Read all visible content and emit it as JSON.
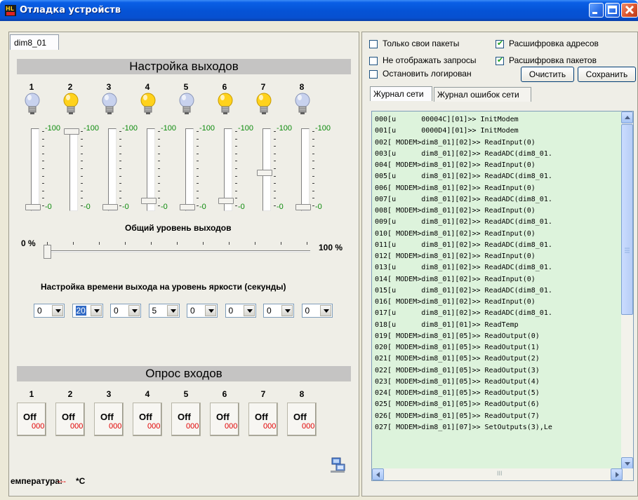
{
  "window": {
    "title": "Отладка устройств"
  },
  "device_tab": {
    "label": "dim8_01"
  },
  "outputs": {
    "header": "Настройка выходов",
    "channels": [
      {
        "num": "1",
        "lamp_on": false,
        "max": "-100",
        "min": "-0",
        "level": 0
      },
      {
        "num": "2",
        "lamp_on": true,
        "max": "-100",
        "min": "-0",
        "level": 100
      },
      {
        "num": "3",
        "lamp_on": false,
        "max": "-100",
        "min": "-0",
        "level": 0
      },
      {
        "num": "4",
        "lamp_on": true,
        "max": "-100",
        "min": "-0",
        "level": 8
      },
      {
        "num": "5",
        "lamp_on": false,
        "max": "-100",
        "min": "-0",
        "level": 0
      },
      {
        "num": "6",
        "lamp_on": true,
        "max": "-100",
        "min": "-0",
        "level": 8
      },
      {
        "num": "7",
        "lamp_on": true,
        "max": "-100",
        "min": "-0",
        "level": 45
      },
      {
        "num": "8",
        "lamp_on": false,
        "max": "-100",
        "min": "-0",
        "level": 0
      }
    ],
    "general_label": "Общий уровень выходов",
    "general_min": "0 %",
    "general_max": "100 %",
    "general_level": 0,
    "time_label": "Настройка времени выхода на уровень яркости (секунды)",
    "time_values": [
      "0",
      "20",
      "0",
      "5",
      "0",
      "0",
      "0",
      "0"
    ]
  },
  "inputs": {
    "header": "Опрос входов",
    "channels": [
      {
        "num": "1",
        "state": "Off",
        "code": "000"
      },
      {
        "num": "2",
        "state": "Off",
        "code": "000"
      },
      {
        "num": "3",
        "state": "Off",
        "code": "000"
      },
      {
        "num": "4",
        "state": "Off",
        "code": "000"
      },
      {
        "num": "5",
        "state": "Off",
        "code": "000"
      },
      {
        "num": "6",
        "state": "Off",
        "code": "000"
      },
      {
        "num": "7",
        "state": "Off",
        "code": "000"
      },
      {
        "num": "8",
        "state": "Off",
        "code": "000"
      }
    ]
  },
  "temperature": {
    "label": "емпература:",
    "value": "---",
    "unit": "*C"
  },
  "options": {
    "own_packets": {
      "label": "Только свои пакеты",
      "checked": false
    },
    "decode_addresses": {
      "label": "Расшифровка адресов",
      "checked": true
    },
    "hide_requests": {
      "label": "Не отображать запросы",
      "checked": false
    },
    "decode_packets": {
      "label": "Расшифровка пакетов",
      "checked": true
    },
    "stop_logging": {
      "label": "Остановить логирован",
      "checked": false
    }
  },
  "buttons": {
    "clear": "Очистить",
    "save": "Сохранить"
  },
  "log_tabs": [
    "Журнал сети",
    "Журнал ошибок сети"
  ],
  "log_lines": [
    "000[u      00004C][01]>> InitModem",
    "001[u      0000D4][01]>> InitModem",
    "002[ MODEM>dim8_01][02]>> ReadInput(0)",
    "003[u      dim8_01][02]>> ReadADC(dim8_01.",
    "004[ MODEM>dim8_01][02]>> ReadInput(0)",
    "005[u      dim8_01][02]>> ReadADC(dim8_01.",
    "006[ MODEM>dim8_01][02]>> ReadInput(0)",
    "007[u      dim8_01][02]>> ReadADC(dim8_01.",
    "008[ MODEM>dim8_01][02]>> ReadInput(0)",
    "009[u      dim8_01][02]>> ReadADC(dim8_01.",
    "010[ MODEM>dim8_01][02]>> ReadInput(0)",
    "011[u      dim8_01][02]>> ReadADC(dim8_01.",
    "012[ MODEM>dim8_01][02]>> ReadInput(0)",
    "013[u      dim8_01][02]>> ReadADC(dim8_01.",
    "014[ MODEM>dim8_01][02]>> ReadInput(0)",
    "015[u      dim8_01][02]>> ReadADC(dim8_01.",
    "016[ MODEM>dim8_01][02]>> ReadInput(0)",
    "017[u      dim8_01][02]>> ReadADC(dim8_01.",
    "018[u      dim8_01][01]>> ReadTemp",
    "019[ MODEM>dim8_01][05]>> ReadOutput(0)",
    "020[ MODEM>dim8_01][05]>> ReadOutput(1)",
    "021[ MODEM>dim8_01][05]>> ReadOutput(2)",
    "022[ MODEM>dim8_01][05]>> ReadOutput(3)",
    "023[ MODEM>dim8_01][05]>> ReadOutput(4)",
    "024[ MODEM>dim8_01][05]>> ReadOutput(5)",
    "025[ MODEM>dim8_01][05]>> ReadOutput(6)",
    "026[ MODEM>dim8_01][05]>> ReadOutput(7)",
    "027[ MODEM>dim8_01][07]>> SetOutputs(3),Le"
  ],
  "hscroll_grip": "III",
  "colors": {
    "lamp_on": "#ffd21c",
    "lamp_off": "#c8d2ee",
    "green_label": "#0b8a0b",
    "red_value": "#e00000",
    "log_bg": "#ddf3dc"
  }
}
